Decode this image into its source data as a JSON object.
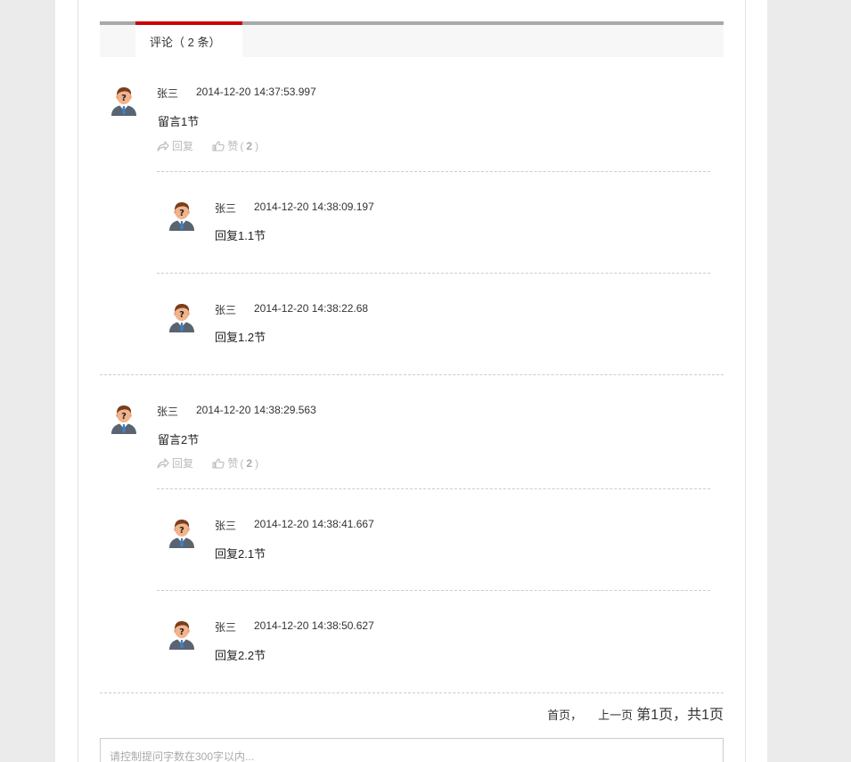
{
  "tab": {
    "label": "评论（ 2 条）"
  },
  "comments": [
    {
      "user": "张三",
      "time": "2014-12-20 14:37:53.997",
      "text": "留言1节",
      "reply_label": "回复",
      "like_label": "赞",
      "like_open": "(",
      "like_count": "2",
      "like_close": ")",
      "replies": [
        {
          "user": "张三",
          "time": "2014-12-20 14:38:09.197",
          "text": "回复1.1节"
        },
        {
          "user": "张三",
          "time": "2014-12-20 14:38:22.68",
          "text": "回复1.2节"
        }
      ]
    },
    {
      "user": "张三",
      "time": "2014-12-20 14:38:29.563",
      "text": "留言2节",
      "reply_label": "回复",
      "like_label": "赞",
      "like_open": "(",
      "like_count": "2",
      "like_close": ")",
      "replies": [
        {
          "user": "张三",
          "time": "2014-12-20 14:38:41.667",
          "text": "回复2.1节"
        },
        {
          "user": "张三",
          "time": "2014-12-20 14:38:50.627",
          "text": "回复2.2节"
        }
      ]
    }
  ],
  "pager": {
    "first": "首页",
    "comma": "，",
    "prev": "上一页",
    "current": "第1页，共1页"
  },
  "input": {
    "placeholder": "请控制提问字数在300字以内..."
  },
  "colors": {
    "accent": "#cc0000",
    "tab_bar": "#a8a8a8",
    "muted": "#bbbbbb"
  },
  "icons": {
    "avatar": "user-avatar-icon",
    "reply": "reply-arrow-icon",
    "like": "thumbs-up-icon"
  }
}
